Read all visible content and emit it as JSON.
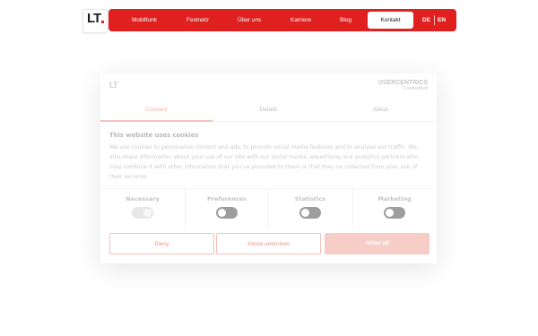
{
  "header": {
    "logo_text": "LT",
    "nav": [
      "Mobilfunk",
      "Festnetz",
      "Über uns",
      "Karriere",
      "Blog"
    ],
    "contact_label": "Kontakt",
    "languages": [
      "DE",
      "EN"
    ],
    "brand_color": "#e0201f"
  },
  "consent": {
    "logo_text": "LT",
    "brand_name": "USERCENTRICS",
    "brand_sub": "Cookiebot",
    "tabs": [
      "Consent",
      "Details",
      "About"
    ],
    "active_tab": "Consent",
    "title": "This website uses cookies",
    "text": "We use cookies to personalise content and ads, to provide social media features and to analyse our traffic. We also share information about your use of our site with our social media, advertising and analytics partners who may combine it with other information that you’ve provided to them or that they’ve collected from your use of their services.",
    "categories": [
      {
        "label": "Necessary",
        "enabled": true,
        "locked": true
      },
      {
        "label": "Preferences",
        "enabled": false,
        "locked": false
      },
      {
        "label": "Statistics",
        "enabled": false,
        "locked": false
      },
      {
        "label": "Marketing",
        "enabled": false,
        "locked": false
      }
    ],
    "buttons": {
      "deny": "Deny",
      "allow_selection": "Allow selection",
      "allow_all": "Allow all"
    },
    "accent_color": "#f0b1a8"
  }
}
